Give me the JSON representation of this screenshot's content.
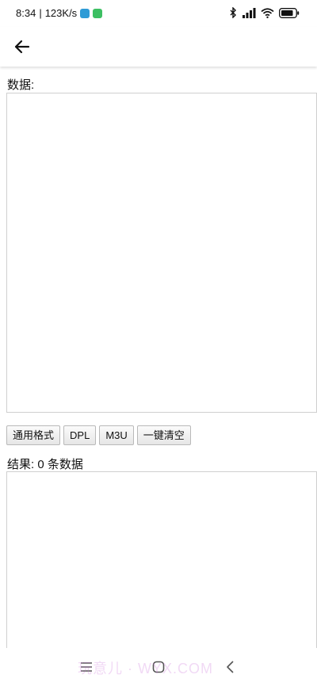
{
  "status_bar": {
    "time": "8:34",
    "speed": "123K/s",
    "separator": "|"
  },
  "app_bar": {
    "back_icon": "arrow-left-icon"
  },
  "input_section": {
    "label": "数据:",
    "value": ""
  },
  "buttons": {
    "general": "通用格式",
    "dpl": "DPL",
    "m3u": "M3U",
    "clear": "一键清空"
  },
  "result_section": {
    "label": "结果: 0 条数据",
    "value": ""
  },
  "nav_bar": {
    "menu_icon": "menu-icon",
    "home_icon": "home-icon",
    "back_icon": "back-triangle-icon"
  },
  "watermark": "玩意儿 · WYX.COM",
  "colors": {
    "accent_app_icon_1": "#2e9bd6",
    "accent_app_icon_2": "#3cbf62",
    "border": "#cfcfcf"
  }
}
